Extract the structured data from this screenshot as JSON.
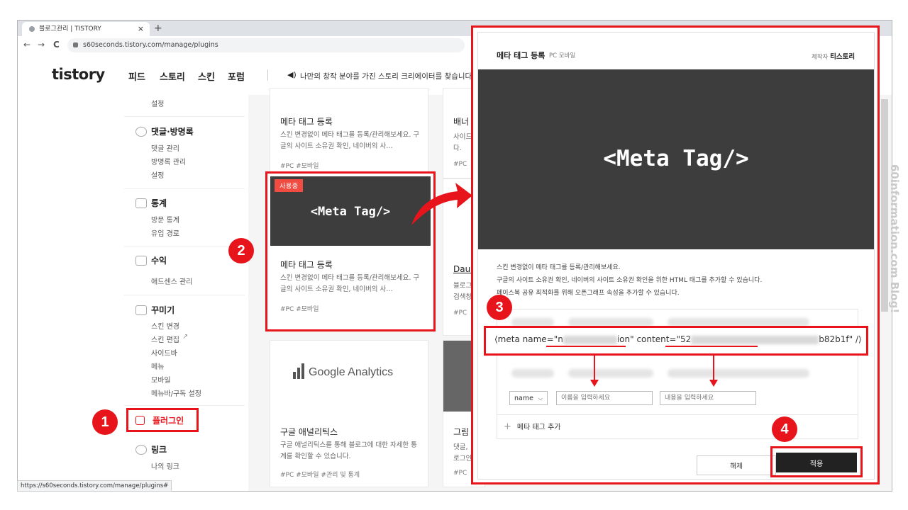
{
  "browser": {
    "tab_title": "블로그관리 | TISTORY",
    "tab_close": "×",
    "new_tab": "+",
    "nav": {
      "back": "←",
      "forward": "→",
      "reload": "C"
    },
    "url": "s60seconds.tistory.com/manage/plugins",
    "status_url": "https://s60seconds.tistory.com/manage/plugins#"
  },
  "header": {
    "logo": "tistory",
    "nav": [
      "피드",
      "스토리",
      "스킨",
      "포럼"
    ],
    "notice": "나만의 창작 분야를 가진 스토리 크리에이터를 찾습니다."
  },
  "sidebar": {
    "top_item": "설정",
    "groups": [
      {
        "title": "댓글·방명록",
        "items": [
          "댓글 관리",
          "방명록 관리",
          "설정"
        ]
      },
      {
        "title": "통계",
        "items": [
          "방문 통계",
          "유입 경로"
        ]
      },
      {
        "title": "수익",
        "items": [
          "애드센스 관리"
        ]
      },
      {
        "title": "꾸미기",
        "items": [
          "스킨 변경",
          "스킨 편집",
          "사이드바",
          "메뉴",
          "모바일",
          "메뉴바/구독 설정"
        ]
      },
      {
        "title": "링크",
        "items": [
          "나의 링크"
        ]
      }
    ],
    "plugin_label": "플러그인"
  },
  "cards": {
    "top_left": {
      "title": "메타 태그 등록",
      "desc": "스킨 변경없이 메타 태그를 등록/관리해보세요. 구글의 사이트 소유권 확인, 네이버의 사…",
      "tags": "#PC  #모바일"
    },
    "top_right": {
      "title": "배너",
      "desc": "사이드",
      "desc2": "다.",
      "tags": "#PC"
    },
    "featured": {
      "badge": "사용중",
      "thumb": "<Meta Tag/>",
      "title": "메타 태그 등록",
      "desc": "스킨 변경없이 메타 태그를 등록/관리해보세요. 구글의 사이트 소유권 확인, 네이버의 사…",
      "tags": "#PC  #모바일"
    },
    "mid_right": {
      "title": "Daum",
      "desc": "블로그",
      "desc2": "검색창",
      "tags": "#PC"
    },
    "ga": {
      "thumb": "Google Analytics",
      "title": "구글 애널리틱스",
      "desc": "구글 애널리틱스를 통해 블로그에 대한 자세한 통계를 확인할 수 있습니다.",
      "tags": "#PC  #모바일  #관리 및 통계"
    },
    "bottom_right": {
      "title": "그림",
      "desc": "댓글,",
      "desc2": "로그인",
      "tags": "#PC"
    }
  },
  "modal": {
    "title": "메타 태그 등록",
    "subtitle": "PC 모바일",
    "maker_label": "제작자",
    "maker": "티스토리",
    "hero": "<Meta Tag/>",
    "desc": [
      "스킨 변경없이 메타 태그를 등록/관리해보세요.",
      "구글의 사이트 소유권 확인, 네이버의 사이트 소유권 확인을 위한 HTML 태그를 추가할 수 있습니다.",
      "페이스북 공유 최적화를 위해 오픈그래프 속성을 추가할 수 있습니다."
    ],
    "meta_line_start": "⟨meta name=\"n",
    "meta_line_mid1": "ion\" content=\"52",
    "meta_line_end": "b82b1f\" /⟩",
    "select_value": "name",
    "name_placeholder": "이름을 입력하세요",
    "content_placeholder": "내용을 입력하세요",
    "add_label": "메타 태그 추가",
    "cancel_label": "해제",
    "apply_label": "적용"
  },
  "steps": [
    "1",
    "2",
    "3",
    "4"
  ],
  "watermark": "60information.com  Blog!",
  "colors": {
    "accent_red": "#e8141b",
    "dark_thumb": "#3d3d3d",
    "badge": "#f04c41"
  }
}
